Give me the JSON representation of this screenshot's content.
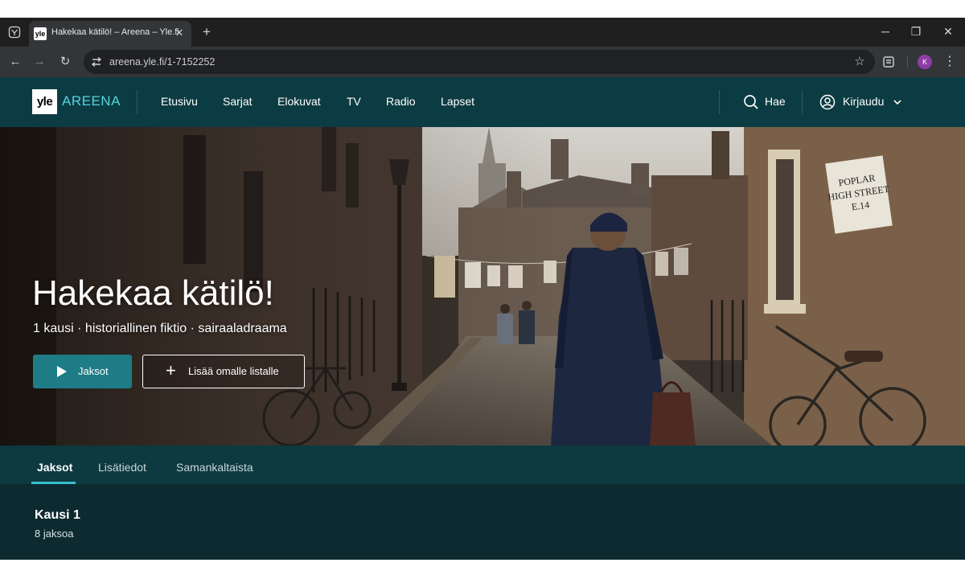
{
  "browser": {
    "tab_title": "Hakekaa kätilö! – Areena – Yle.fi",
    "favicon_text": "yle",
    "url": "areena.yle.fi/1-7152252",
    "profile_initial": "K"
  },
  "site": {
    "logo_box": "yle",
    "logo_text": "AREENA",
    "nav": [
      "Etusivu",
      "Sarjat",
      "Elokuvat",
      "TV",
      "Radio",
      "Lapset"
    ],
    "search_label": "Hae",
    "login_label": "Kirjaudu"
  },
  "hero": {
    "title": "Hakekaa kätilö!",
    "meta": "1 kausi · historiallinen fiktio · sairaaladraama",
    "play_label": "Jaksot",
    "add_label": "Lisää omalle listalle",
    "street_sign": [
      "POPLAR",
      "HIGH STREET",
      "E.14"
    ]
  },
  "content_tabs": [
    "Jaksot",
    "Lisätiedot",
    "Samankaltaista"
  ],
  "season": {
    "title": "Kausi 1",
    "episodes": "8 jaksoa"
  },
  "colors": {
    "header_bg": "#0c3c43",
    "accent": "#1d7c86",
    "logo_accent": "#54d3dc"
  }
}
